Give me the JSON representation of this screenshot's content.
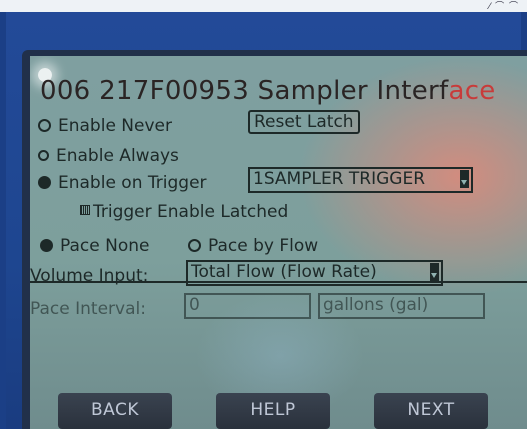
{
  "screen": {
    "title_main": "006 217F00953 Sampler Interf",
    "title_tail": "ace"
  },
  "enable": {
    "never_label": "Enable Never",
    "always_label": "Enable Always",
    "trigger_label": "Enable on Trigger",
    "selected": "Enable on Trigger",
    "reset_latch_label": "Reset Latch",
    "trigger_select_value": "1SAMPLER TRIGGER",
    "latched_label": "Trigger Enable Latched"
  },
  "pace": {
    "none_label": "Pace None",
    "flow_label": "Pace by Flow",
    "selected": "Pace None",
    "volume_input_label": "Volume Input:",
    "volume_input_value": "Total Flow (Flow Rate)",
    "interval_label": "Pace Interval:",
    "interval_value": "0",
    "units_value": "gallons (gal)"
  },
  "softkeys": {
    "back": "BACK",
    "help": "HELP",
    "next": "NEXT"
  }
}
